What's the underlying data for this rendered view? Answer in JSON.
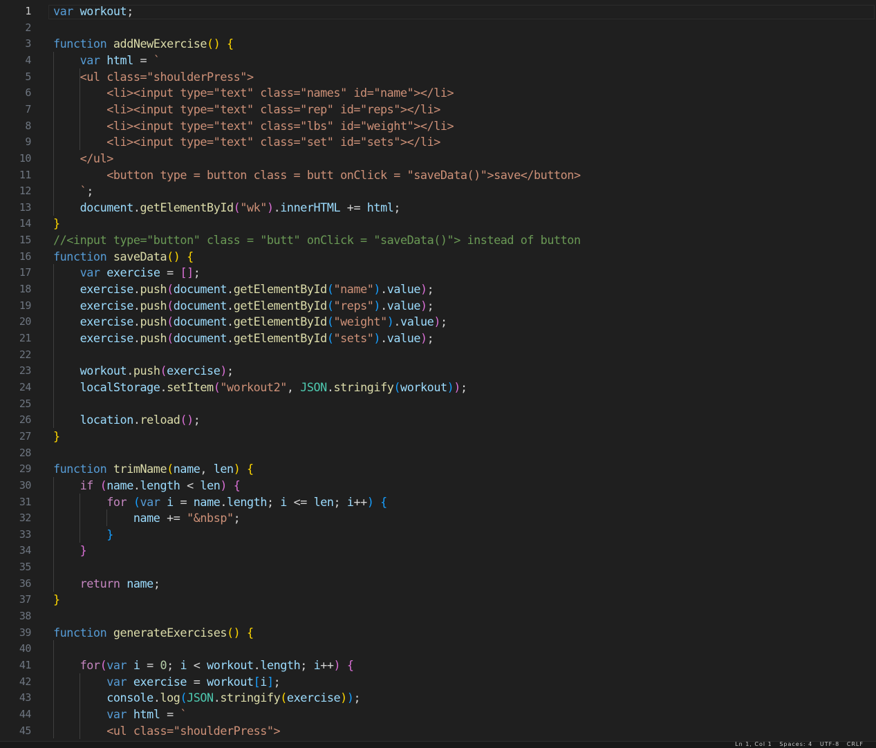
{
  "editor": {
    "active_line": 1,
    "line_numbers": [
      "1",
      "2",
      "3",
      "4",
      "5",
      "6",
      "7",
      "8",
      "9",
      "10",
      "11",
      "12",
      "13",
      "14",
      "15",
      "16",
      "17",
      "18",
      "19",
      "20",
      "21",
      "22",
      "23",
      "24",
      "25",
      "26",
      "27",
      "28",
      "29",
      "30",
      "31",
      "32",
      "33",
      "34",
      "35",
      "36",
      "37",
      "38",
      "39",
      "40",
      "41",
      "42",
      "43",
      "44",
      "45"
    ],
    "colors": {
      "background": "#1f1f1f",
      "keyword": "#569cd6",
      "function": "#dcdcaa",
      "variable": "#9cdcfe",
      "string": "#ce9178",
      "comment": "#6a9955",
      "control": "#c586c0",
      "class": "#4ec9b0",
      "bracket_1": "#ffd700",
      "bracket_2": "#da70d6",
      "bracket_3": "#179fff"
    },
    "lines": [
      [
        [
          "kw",
          "var"
        ],
        [
          "op",
          " "
        ],
        [
          "vr",
          "workout"
        ],
        [
          "op",
          ";"
        ]
      ],
      [],
      [
        [
          "kw",
          "function"
        ],
        [
          "op",
          " "
        ],
        [
          "fn",
          "addNewExercise"
        ],
        [
          "p1",
          "()"
        ],
        [
          "op",
          " "
        ],
        [
          "p1",
          "{"
        ]
      ],
      [
        [
          "op",
          "    "
        ],
        [
          "kw",
          "var"
        ],
        [
          "op",
          " "
        ],
        [
          "vr",
          "html"
        ],
        [
          "op",
          " = "
        ],
        [
          "st",
          "`"
        ]
      ],
      [
        [
          "st",
          "    <ul class=\"shoulderPress\">"
        ]
      ],
      [
        [
          "st",
          "        <li><input type=\"text\" class=\"names\" id=\"name\"></li>"
        ]
      ],
      [
        [
          "st",
          "        <li><input type=\"text\" class=\"rep\" id=\"reps\"></li>"
        ]
      ],
      [
        [
          "st",
          "        <li><input type=\"text\" class=\"lbs\" id=\"weight\"></li>"
        ]
      ],
      [
        [
          "st",
          "        <li><input type=\"text\" class=\"set\" id=\"sets\"></li>"
        ]
      ],
      [
        [
          "st",
          "    </ul>"
        ]
      ],
      [
        [
          "st",
          "        <button type = button class = butt onClick = \"saveData()\">save</button>"
        ]
      ],
      [
        [
          "st",
          "    `"
        ],
        [
          "op",
          ";"
        ]
      ],
      [
        [
          "op",
          "    "
        ],
        [
          "vr",
          "document"
        ],
        [
          "op",
          "."
        ],
        [
          "fn",
          "getElementById"
        ],
        [
          "p2",
          "("
        ],
        [
          "st",
          "\"wk\""
        ],
        [
          "p2",
          ")"
        ],
        [
          "op",
          "."
        ],
        [
          "vr",
          "innerHTML"
        ],
        [
          "op",
          " += "
        ],
        [
          "vr",
          "html"
        ],
        [
          "op",
          ";"
        ]
      ],
      [
        [
          "p1",
          "}"
        ]
      ],
      [
        [
          "cm",
          "//<input type=\"button\" class = \"butt\" onClick = \"saveData()\"> instead of button"
        ]
      ],
      [
        [
          "kw",
          "function"
        ],
        [
          "op",
          " "
        ],
        [
          "fn",
          "saveData"
        ],
        [
          "p1",
          "()"
        ],
        [
          "op",
          " "
        ],
        [
          "p1",
          "{"
        ]
      ],
      [
        [
          "op",
          "    "
        ],
        [
          "kw",
          "var"
        ],
        [
          "op",
          " "
        ],
        [
          "vr",
          "exercise"
        ],
        [
          "op",
          " = "
        ],
        [
          "p2",
          "[]"
        ],
        [
          "op",
          ";"
        ]
      ],
      [
        [
          "op",
          "    "
        ],
        [
          "vr",
          "exercise"
        ],
        [
          "op",
          "."
        ],
        [
          "fn",
          "push"
        ],
        [
          "p2",
          "("
        ],
        [
          "vr",
          "document"
        ],
        [
          "op",
          "."
        ],
        [
          "fn",
          "getElementById"
        ],
        [
          "p3",
          "("
        ],
        [
          "st",
          "\"name\""
        ],
        [
          "p3",
          ")"
        ],
        [
          "op",
          "."
        ],
        [
          "vr",
          "value"
        ],
        [
          "p2",
          ")"
        ],
        [
          "op",
          ";"
        ]
      ],
      [
        [
          "op",
          "    "
        ],
        [
          "vr",
          "exercise"
        ],
        [
          "op",
          "."
        ],
        [
          "fn",
          "push"
        ],
        [
          "p2",
          "("
        ],
        [
          "vr",
          "document"
        ],
        [
          "op",
          "."
        ],
        [
          "fn",
          "getElementById"
        ],
        [
          "p3",
          "("
        ],
        [
          "st",
          "\"reps\""
        ],
        [
          "p3",
          ")"
        ],
        [
          "op",
          "."
        ],
        [
          "vr",
          "value"
        ],
        [
          "p2",
          ")"
        ],
        [
          "op",
          ";"
        ]
      ],
      [
        [
          "op",
          "    "
        ],
        [
          "vr",
          "exercise"
        ],
        [
          "op",
          "."
        ],
        [
          "fn",
          "push"
        ],
        [
          "p2",
          "("
        ],
        [
          "vr",
          "document"
        ],
        [
          "op",
          "."
        ],
        [
          "fn",
          "getElementById"
        ],
        [
          "p3",
          "("
        ],
        [
          "st",
          "\"weight\""
        ],
        [
          "p3",
          ")"
        ],
        [
          "op",
          "."
        ],
        [
          "vr",
          "value"
        ],
        [
          "p2",
          ")"
        ],
        [
          "op",
          ";"
        ]
      ],
      [
        [
          "op",
          "    "
        ],
        [
          "vr",
          "exercise"
        ],
        [
          "op",
          "."
        ],
        [
          "fn",
          "push"
        ],
        [
          "p2",
          "("
        ],
        [
          "vr",
          "document"
        ],
        [
          "op",
          "."
        ],
        [
          "fn",
          "getElementById"
        ],
        [
          "p3",
          "("
        ],
        [
          "st",
          "\"sets\""
        ],
        [
          "p3",
          ")"
        ],
        [
          "op",
          "."
        ],
        [
          "vr",
          "value"
        ],
        [
          "p2",
          ")"
        ],
        [
          "op",
          ";"
        ]
      ],
      [],
      [
        [
          "op",
          "    "
        ],
        [
          "vr",
          "workout"
        ],
        [
          "op",
          "."
        ],
        [
          "fn",
          "push"
        ],
        [
          "p2",
          "("
        ],
        [
          "vr",
          "exercise"
        ],
        [
          "p2",
          ")"
        ],
        [
          "op",
          ";"
        ]
      ],
      [
        [
          "op",
          "    "
        ],
        [
          "vr",
          "localStorage"
        ],
        [
          "op",
          "."
        ],
        [
          "fn",
          "setItem"
        ],
        [
          "p2",
          "("
        ],
        [
          "st",
          "\"workout2\""
        ],
        [
          "op",
          ", "
        ],
        [
          "cl",
          "JSON"
        ],
        [
          "op",
          "."
        ],
        [
          "fn",
          "stringify"
        ],
        [
          "p3",
          "("
        ],
        [
          "vr",
          "workout"
        ],
        [
          "p3",
          ")"
        ],
        [
          "p2",
          ")"
        ],
        [
          "op",
          ";"
        ]
      ],
      [],
      [
        [
          "op",
          "    "
        ],
        [
          "vr",
          "location"
        ],
        [
          "op",
          "."
        ],
        [
          "fn",
          "reload"
        ],
        [
          "p2",
          "()"
        ],
        [
          "op",
          ";"
        ]
      ],
      [
        [
          "p1",
          "}"
        ]
      ],
      [],
      [
        [
          "kw",
          "function"
        ],
        [
          "op",
          " "
        ],
        [
          "fn",
          "trimName"
        ],
        [
          "p1",
          "("
        ],
        [
          "vr",
          "name"
        ],
        [
          "op",
          ", "
        ],
        [
          "vr",
          "len"
        ],
        [
          "p1",
          ")"
        ],
        [
          "op",
          " "
        ],
        [
          "p1",
          "{"
        ]
      ],
      [
        [
          "op",
          "    "
        ],
        [
          "ct",
          "if"
        ],
        [
          "op",
          " "
        ],
        [
          "p2",
          "("
        ],
        [
          "vr",
          "name"
        ],
        [
          "op",
          "."
        ],
        [
          "vr",
          "length"
        ],
        [
          "op",
          " < "
        ],
        [
          "vr",
          "len"
        ],
        [
          "p2",
          ")"
        ],
        [
          "op",
          " "
        ],
        [
          "p2",
          "{"
        ]
      ],
      [
        [
          "op",
          "        "
        ],
        [
          "ct",
          "for"
        ],
        [
          "op",
          " "
        ],
        [
          "p3",
          "("
        ],
        [
          "kw",
          "var"
        ],
        [
          "op",
          " "
        ],
        [
          "vr",
          "i"
        ],
        [
          "op",
          " = "
        ],
        [
          "vr",
          "name"
        ],
        [
          "op",
          "."
        ],
        [
          "vr",
          "length"
        ],
        [
          "op",
          "; "
        ],
        [
          "vr",
          "i"
        ],
        [
          "op",
          " <= "
        ],
        [
          "vr",
          "len"
        ],
        [
          "op",
          "; "
        ],
        [
          "vr",
          "i"
        ],
        [
          "op",
          "++"
        ],
        [
          "p3",
          ")"
        ],
        [
          "op",
          " "
        ],
        [
          "p3",
          "{"
        ]
      ],
      [
        [
          "op",
          "            "
        ],
        [
          "vr",
          "name"
        ],
        [
          "op",
          " += "
        ],
        [
          "st",
          "\"&nbsp\""
        ],
        [
          "op",
          ";"
        ]
      ],
      [
        [
          "op",
          "        "
        ],
        [
          "p3",
          "}"
        ]
      ],
      [
        [
          "op",
          "    "
        ],
        [
          "p2",
          "}"
        ]
      ],
      [],
      [
        [
          "op",
          "    "
        ],
        [
          "ct",
          "return"
        ],
        [
          "op",
          " "
        ],
        [
          "vr",
          "name"
        ],
        [
          "op",
          ";"
        ]
      ],
      [
        [
          "p1",
          "}"
        ]
      ],
      [],
      [
        [
          "kw",
          "function"
        ],
        [
          "op",
          " "
        ],
        [
          "fn",
          "generateExercises"
        ],
        [
          "p1",
          "()"
        ],
        [
          "op",
          " "
        ],
        [
          "p1",
          "{"
        ]
      ],
      [],
      [
        [
          "op",
          "    "
        ],
        [
          "ct",
          "for"
        ],
        [
          "p2",
          "("
        ],
        [
          "kw",
          "var"
        ],
        [
          "op",
          " "
        ],
        [
          "vr",
          "i"
        ],
        [
          "op",
          " = "
        ],
        [
          "nm",
          "0"
        ],
        [
          "op",
          "; "
        ],
        [
          "vr",
          "i"
        ],
        [
          "op",
          " < "
        ],
        [
          "vr",
          "workout"
        ],
        [
          "op",
          "."
        ],
        [
          "vr",
          "length"
        ],
        [
          "op",
          "; "
        ],
        [
          "vr",
          "i"
        ],
        [
          "op",
          "++"
        ],
        [
          "p2",
          ")"
        ],
        [
          "op",
          " "
        ],
        [
          "p2",
          "{"
        ]
      ],
      [
        [
          "op",
          "        "
        ],
        [
          "kw",
          "var"
        ],
        [
          "op",
          " "
        ],
        [
          "vr",
          "exercise"
        ],
        [
          "op",
          " = "
        ],
        [
          "vr",
          "workout"
        ],
        [
          "p3",
          "["
        ],
        [
          "vr",
          "i"
        ],
        [
          "p3",
          "]"
        ],
        [
          "op",
          ";"
        ]
      ],
      [
        [
          "op",
          "        "
        ],
        [
          "vr",
          "console"
        ],
        [
          "op",
          "."
        ],
        [
          "fn",
          "log"
        ],
        [
          "p3",
          "("
        ],
        [
          "cl",
          "JSON"
        ],
        [
          "op",
          "."
        ],
        [
          "fn",
          "stringify"
        ],
        [
          "p1",
          "("
        ],
        [
          "vr",
          "exercise"
        ],
        [
          "p1",
          ")"
        ],
        [
          "p3",
          ")"
        ],
        [
          "op",
          ";"
        ]
      ],
      [
        [
          "op",
          "        "
        ],
        [
          "kw",
          "var"
        ],
        [
          "op",
          " "
        ],
        [
          "vr",
          "html"
        ],
        [
          "op",
          " = "
        ],
        [
          "st",
          "`"
        ]
      ],
      [
        [
          "st",
          "        <ul class=\"shoulderPress\">"
        ]
      ]
    ]
  },
  "status_bar": {
    "text": "Ln 1, Col 1   Spaces: 4   UTF-8   CRLF"
  }
}
